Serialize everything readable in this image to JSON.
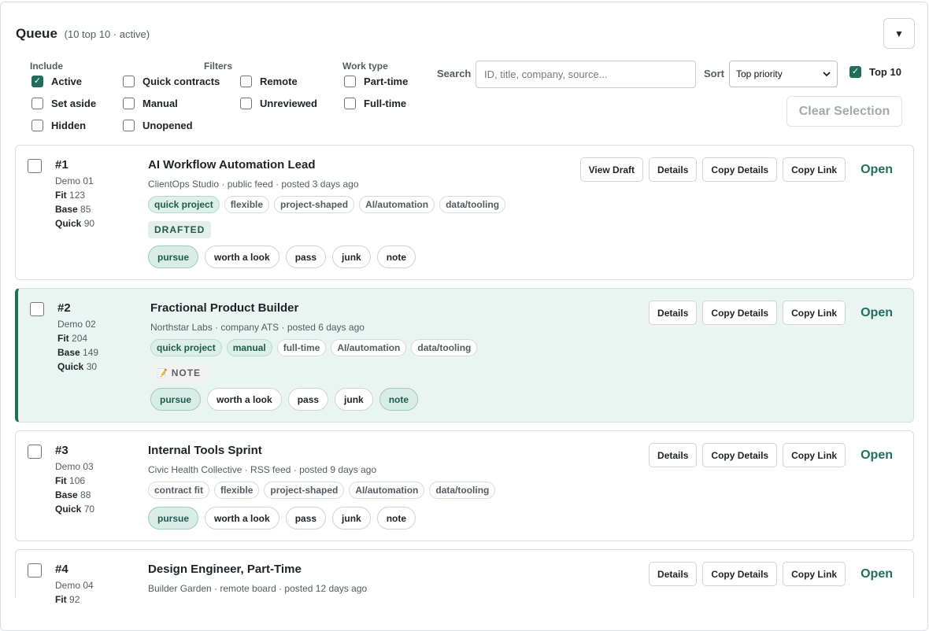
{
  "header": {
    "title": "Queue",
    "subtitle": "(10 top 10 · active)",
    "collapse_icon": "▼"
  },
  "filters": {
    "include_title": "Include",
    "filters_title": "Filters",
    "worktype_title": "Work type",
    "active": "Active",
    "set_aside": "Set aside",
    "hidden": "Hidden",
    "quick_contracts": "Quick contracts",
    "manual": "Manual",
    "unopened": "Unopened",
    "remote": "Remote",
    "unreviewed": "Unreviewed",
    "part_time": "Part-time",
    "full_time": "Full-time",
    "search_label": "Search",
    "search_placeholder": "ID, title, company, source...",
    "sort_label": "Sort",
    "sort_value": "Top priority",
    "top10": "Top 10",
    "clear_selection": "Clear Selection"
  },
  "triage_labels": [
    "pursue",
    "worth a look",
    "pass",
    "junk",
    "note"
  ],
  "actions": {
    "view_draft": "View Draft",
    "details": "Details",
    "copy_details": "Copy Details",
    "copy_link": "Copy Link",
    "open": "Open"
  },
  "items": [
    {
      "rank": "#1",
      "demo": "Demo 01",
      "fit_label": "Fit",
      "fit": "123",
      "base_label": "Base",
      "base": "85",
      "quick_label": "Quick",
      "quick": "90",
      "title": "AI Workflow Automation Lead",
      "source": "ClientOps Studio · public feed · posted 3 days ago",
      "tags": [
        "quick project",
        "flexible",
        "project-shaped",
        "AI/automation",
        "data/tooling"
      ],
      "status": "DRAFTED"
    },
    {
      "rank": "#2",
      "demo": "Demo 02",
      "fit_label": "Fit",
      "fit": "204",
      "base_label": "Base",
      "base": "149",
      "quick_label": "Quick",
      "quick": "30",
      "title": "Fractional Product Builder",
      "source": "Northstar Labs · company ATS · posted 6 days ago",
      "tags": [
        "quick project",
        "manual",
        "full-time",
        "AI/automation",
        "data/tooling"
      ],
      "status": "NOTE",
      "status_icon": "📝"
    },
    {
      "rank": "#3",
      "demo": "Demo 03",
      "fit_label": "Fit",
      "fit": "106",
      "base_label": "Base",
      "base": "88",
      "quick_label": "Quick",
      "quick": "70",
      "title": "Internal Tools Sprint",
      "source": "Civic Health Collective · RSS feed · posted 9 days ago",
      "tags": [
        "contract fit",
        "flexible",
        "project-shaped",
        "AI/automation",
        "data/tooling"
      ]
    },
    {
      "rank": "#4",
      "demo": "Demo 04",
      "fit_label": "Fit",
      "fit": "92",
      "title": "Design Engineer, Part-Time",
      "source": "Builder Garden · remote board · posted 12 days ago"
    }
  ]
}
